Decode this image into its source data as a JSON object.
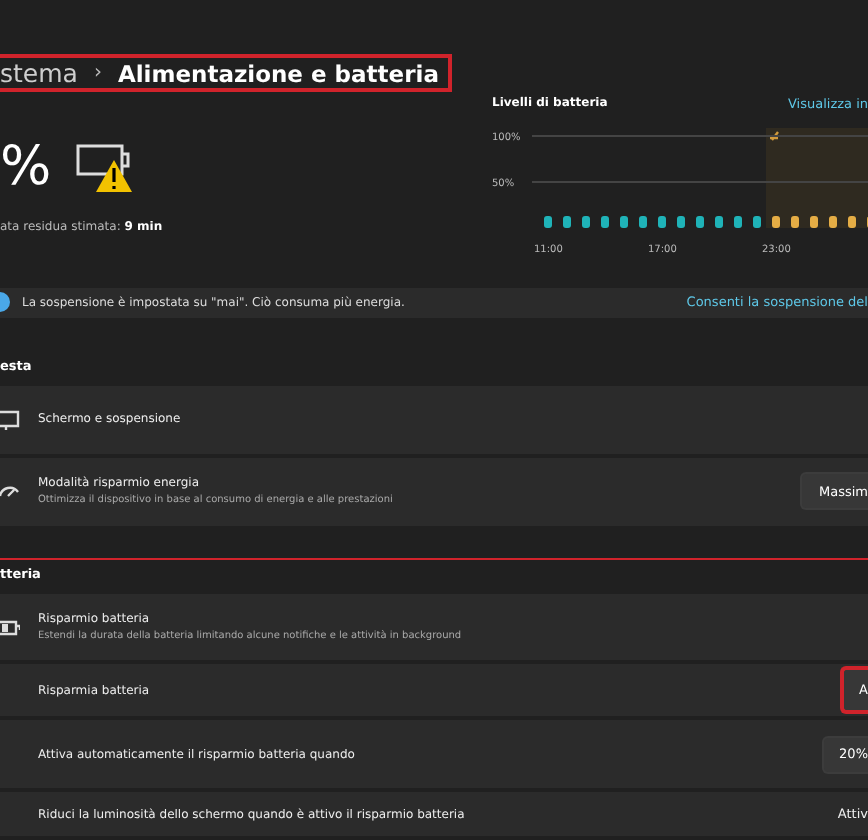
{
  "breadcrumb": {
    "parent": "stema",
    "separator": "›",
    "current": "Alimentazione e batteria"
  },
  "battery": {
    "percent": "%",
    "estimate": "ata residua stimata: **9 min**"
  },
  "battery_chart": {
    "title": "Livelli di batteria",
    "link": "Visualizza in",
    "chart_data": {
      "type": "bar",
      "categories": [
        "11:00",
        null,
        null,
        null,
        null,
        null,
        "17:00",
        null,
        null,
        null,
        null,
        null,
        "23:00",
        null,
        null,
        null,
        null,
        null
      ],
      "ylim": [
        0,
        100
      ],
      "yticks": [
        {
          "value": 50,
          "label": "50%"
        },
        {
          "value": 100,
          "label": "100%"
        }
      ],
      "series": [
        {
          "color": "#1fb3b8",
          "values": [
            13,
            13,
            13,
            13,
            13,
            13,
            13,
            13,
            13,
            13,
            13,
            13,
            null,
            null,
            null,
            null,
            null,
            null
          ]
        },
        {
          "color": "#e5ad45",
          "values": [
            null,
            null,
            null,
            null,
            null,
            null,
            null,
            null,
            null,
            null,
            null,
            null,
            13,
            13,
            13,
            13,
            13,
            13
          ]
        }
      ]
    }
  },
  "notice": {
    "text": "La sospensione è impostata su \"mai\". Ciò consuma più energia.",
    "link": "Consenti la sospensione del"
  },
  "sections": [
    {
      "header": "esta",
      "highlighted": false,
      "rows": [
        {
          "kind": "nav",
          "title": "Schermo e sospensione"
        },
        {
          "kind": "select",
          "title": "Modalità risparmio energia",
          "subtitle": "Ottimizza il dispositivo in base al consumo di energia e alle prestazioni",
          "control": "Massim"
        }
      ]
    },
    {
      "header": "tteria",
      "highlighted": true,
      "rows": [
        {
          "kind": "group",
          "title": "Risparmio batteria",
          "subtitle": "Estendi la durata della batteria limitando alcune notifiche e le attività in background"
        },
        {
          "kind": "button",
          "title": "Risparmia batteria",
          "control": "A",
          "highlighted": true
        },
        {
          "kind": "select",
          "title": "Attiva automaticamente il risparmio batteria quando",
          "control": "20%"
        },
        {
          "kind": "text",
          "title": "Riduci la luminosità dello schermo quando è attivo il risparmio batteria",
          "control": "Attiv"
        }
      ]
    }
  ]
}
